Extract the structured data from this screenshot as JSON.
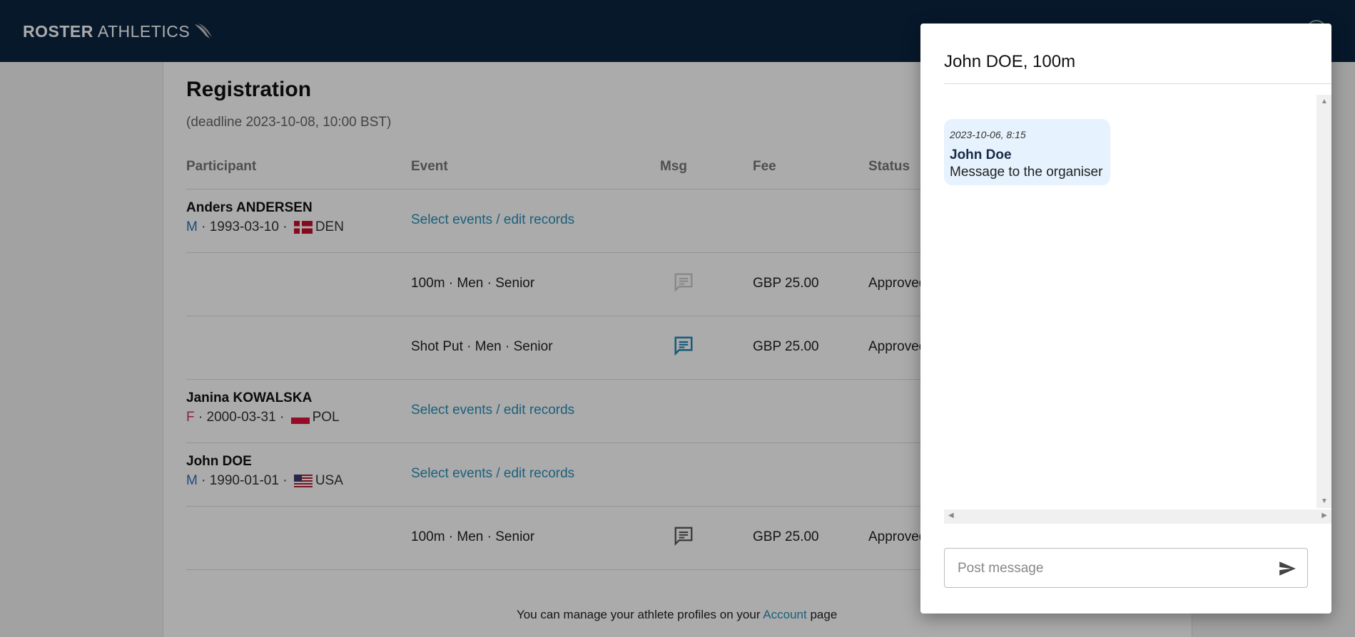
{
  "header": {
    "logo_bold": "ROSTER",
    "logo_light": "ATHLETICS"
  },
  "page": {
    "title": "Registration",
    "deadline": "(deadline 2023-10-08, 10:00 BST)"
  },
  "table": {
    "columns": {
      "participant": "Participant",
      "event": "Event",
      "msg": "Msg",
      "fee": "Fee",
      "status": "Status"
    },
    "rows": [
      {
        "name": "Anders ANDERSEN",
        "sex": "M",
        "dob": "1993-03-10",
        "country": "DEN",
        "link": "Select events / edit records"
      },
      {
        "event": "100m · Men · Senior",
        "fee": "GBP 25.00",
        "status": "Approved"
      },
      {
        "event": "Shot Put · Men · Senior",
        "fee": "GBP 25.00",
        "status": "Approved"
      },
      {
        "name": "Janina KOWALSKA",
        "sex": "F",
        "dob": "2000-03-31",
        "country": "POL",
        "link": "Select events / edit records"
      },
      {
        "name": "John DOE",
        "sex": "M",
        "dob": "1990-01-01",
        "country": "USA",
        "link": "Select events / edit records"
      },
      {
        "event": "100m · Men · Senior",
        "fee": "GBP 25.00",
        "status": "Approved"
      }
    ]
  },
  "footer": {
    "before": "You can manage your athlete profiles on your",
    "link": "Account",
    "after": "page"
  },
  "dialog": {
    "title": "John DOE, 100m",
    "messages": [
      {
        "time": "2023-10-06, 8:15",
        "author": "John Doe",
        "text": "Message to the organiser"
      }
    ],
    "input_placeholder": "Post message"
  },
  "colors": {
    "header_bg": "#0b2440",
    "accent": "#2a8fb8",
    "bubble_bg": "#e6f2fd"
  },
  "icons": {
    "msg": "chat-bubble-icon",
    "send": "send-icon",
    "logo": "wing-icon"
  }
}
